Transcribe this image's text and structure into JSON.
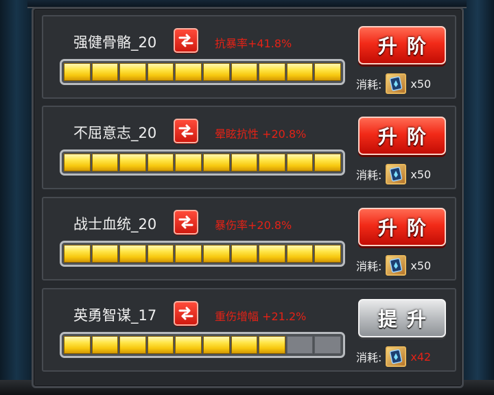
{
  "rows": [
    {
      "name": "强健骨骼_20",
      "bonus": "抗暴率+41.8%",
      "progress_filled": 10,
      "progress_total": 10,
      "action_label": "升阶",
      "action_style": "red",
      "cost_label": "消耗:",
      "cost_qty": "x50",
      "cost_short": false
    },
    {
      "name": "不屈意志_20",
      "bonus": "晕眩抗性 +20.8%",
      "progress_filled": 10,
      "progress_total": 10,
      "action_label": "升阶",
      "action_style": "red",
      "cost_label": "消耗:",
      "cost_qty": "x50",
      "cost_short": false
    },
    {
      "name": "战士血统_20",
      "bonus": "暴伤率+20.8%",
      "progress_filled": 10,
      "progress_total": 10,
      "action_label": "升阶",
      "action_style": "red",
      "cost_label": "消耗:",
      "cost_qty": "x50",
      "cost_short": false
    },
    {
      "name": "英勇智谋_17",
      "bonus": "重伤增幅 +21.2%",
      "progress_filled": 8,
      "progress_total": 10,
      "action_label": "提升",
      "action_style": "gray",
      "cost_label": "消耗:",
      "cost_qty": "x42",
      "cost_short": true
    }
  ],
  "icons": {
    "swap": "swap-arrows-icon",
    "cost_item": "blue-crystal-card-icon"
  },
  "colors": {
    "bonus_text": "#e42216",
    "bar_fill": "#ffe64a",
    "upgrade_button": "#f22a18",
    "improve_button": "#b9bcbf"
  }
}
